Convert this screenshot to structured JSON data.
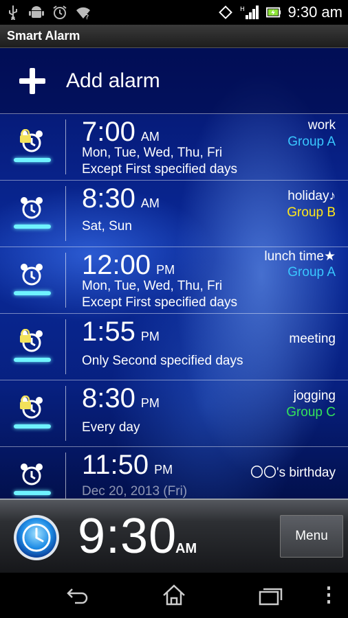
{
  "status_bar": {
    "left_icons": [
      "usb-icon",
      "android-icon",
      "alarm-icon",
      "wifi-question-icon"
    ],
    "right_icons": [
      "rotate-icon",
      "signal-icon",
      "battery-icon"
    ],
    "network_label": "H",
    "time": "9:30 am"
  },
  "app": {
    "title": "Smart Alarm"
  },
  "add_alarm": {
    "label": "Add alarm"
  },
  "alarms": [
    {
      "time": "7:00",
      "ampm": "AM",
      "days_line1": "Mon, Tue, Wed, Thu, Fri",
      "days_line2": "Except First specified days",
      "label": "work",
      "group": "Group A",
      "group_color": "#39c7ff",
      "locked": true
    },
    {
      "time": "8:30",
      "ampm": "AM",
      "days_line1": "Sat, Sun",
      "days_line2": "",
      "label": "holiday♪",
      "group": "Group B",
      "group_color": "#ffe81a",
      "locked": false
    },
    {
      "time": "12:00",
      "ampm": "PM",
      "days_line1": "Mon, Tue, Wed, Thu, Fri",
      "days_line2": "Except First specified days",
      "label": "lunch time★",
      "group": "Group A",
      "group_color": "#39c7ff",
      "locked": false
    },
    {
      "time": "1:55",
      "ampm": "PM",
      "days_line1": "Only Second specified days",
      "days_line2": "",
      "label": "meeting",
      "group": "",
      "group_color": "",
      "locked": true
    },
    {
      "time": "8:30",
      "ampm": "PM",
      "days_line1": "Every day",
      "days_line2": "",
      "label": "jogging",
      "group": "Group C",
      "group_color": "#34e35a",
      "locked": true
    },
    {
      "time": "11:50",
      "ampm": "PM",
      "days_line1": "Dec 20, 2013 (Fri)",
      "days_line2": "",
      "label": "〇〇's birthday",
      "group": "",
      "group_color": "",
      "locked": false
    }
  ],
  "clock": {
    "time": "9:30",
    "ampm": "AM"
  },
  "menu": {
    "label": "Menu"
  },
  "nav": [
    "back-icon",
    "home-icon",
    "recent-apps-icon",
    "overflow-menu-icon"
  ]
}
